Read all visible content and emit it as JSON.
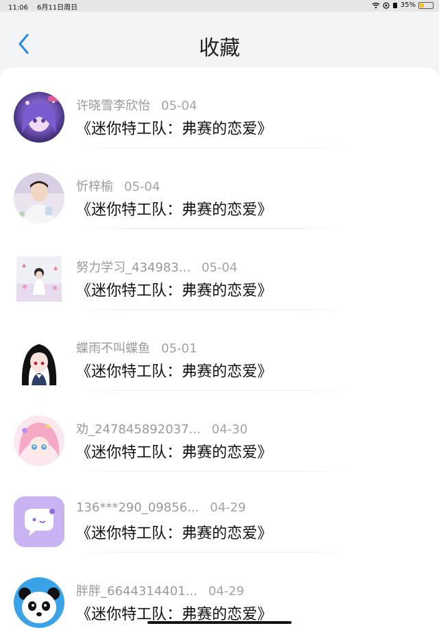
{
  "status": {
    "time": "11:06",
    "date": "6月11日周日",
    "battery": "35%",
    "battery_level": 0.35
  },
  "header": {
    "title": "收藏"
  },
  "items": [
    {
      "user": "许晓雪李欣怡",
      "date": "05-04",
      "work": "《迷你特工队：弗赛的恋爱》",
      "avatar": "anime-purple-avatar"
    },
    {
      "user": "忻梓榆",
      "date": "05-04",
      "work": "《迷你特工队：弗赛的恋爱》",
      "avatar": "photo-boy-avatar"
    },
    {
      "user": "努力学习_434983...",
      "date": "05-04",
      "work": "《迷你特工队：弗赛的恋爱》",
      "avatar": "girl-hearts-avatar"
    },
    {
      "user": "蝶雨不叫蝶鱼",
      "date": "05-01",
      "work": "《迷你特工队：弗赛的恋爱》",
      "avatar": "anime-black-hair-avatar"
    },
    {
      "user": "劝_247845892037...",
      "date": "04-30",
      "work": "《迷你特工队：弗赛的恋爱》",
      "avatar": "anime-pink-avatar"
    },
    {
      "user": "136***290_09856...",
      "date": "04-29",
      "work": "《迷你特工队：弗赛的恋爱》",
      "avatar": "chat-bubble-avatar"
    },
    {
      "user": "胖胖_6644314401...",
      "date": "04-29",
      "work": "《迷你特工队：弗赛的恋爱》",
      "avatar": "panda-avatar"
    }
  ],
  "colors": {
    "accent": "#2e8de3",
    "divider": "#ececec"
  }
}
